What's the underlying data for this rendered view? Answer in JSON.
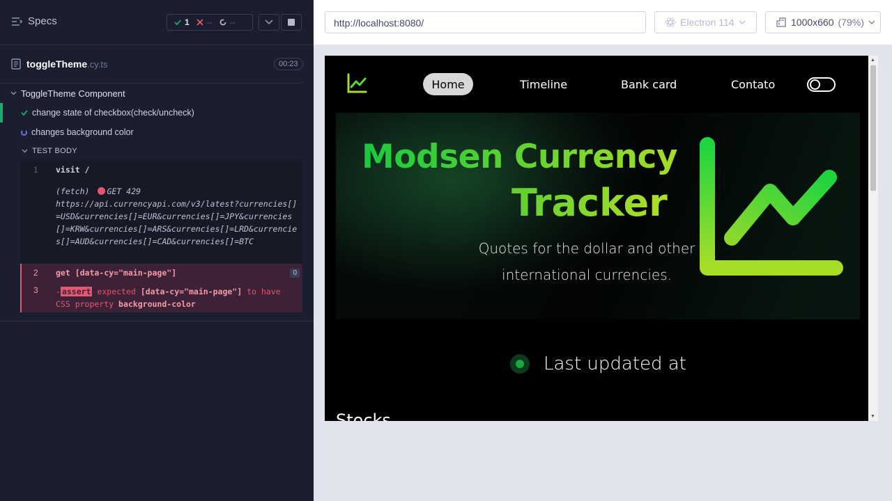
{
  "runner": {
    "specs_label": "Specs",
    "stats": {
      "passed": "1",
      "failed": "--",
      "pending": "--"
    },
    "spec_file": {
      "name": "toggleTheme",
      "ext": ".cy.ts",
      "duration": "00:23"
    },
    "suite": "ToggleTheme Component",
    "tests": [
      {
        "title": "change state of checkbox(check/uncheck)",
        "state": "passed"
      },
      {
        "title": "changes background color",
        "state": "running"
      }
    ],
    "test_body_label": "TEST BODY",
    "commands": [
      {
        "num": "1",
        "text": "visit  /",
        "fetch_label": "(fetch)",
        "fetch_status": "GET 429",
        "fetch_url": "https://api.currencyapi.com/v3/latest?currencies[]=USD&currencies[]=EUR&currencies[]=JPY&currencies[]=KRW&currencies[]=ARS&currencies[]=LRD&currencies[]=AUD&currencies[]=CAD&currencies[]=BTC"
      },
      {
        "num": "2",
        "text": "get  [data-cy=\"main-page\"]",
        "badge": "0"
      },
      {
        "num": "3",
        "dash": "-",
        "keyword": "assert",
        "part1": "expected",
        "selector": "[data-cy=\"main-page\"]",
        "part2": "to have CSS property",
        "prop": "background-color"
      }
    ]
  },
  "browser": {
    "url": "http://localhost:8080/",
    "browser_name": "Electron 114",
    "viewport": "1000x660",
    "zoom": "(79%)"
  },
  "app": {
    "nav": [
      "Home",
      "Timeline",
      "Bank card",
      "Contato"
    ],
    "hero_title_line1": "Modsen Currency",
    "hero_title_line2": "Tracker",
    "hero_subtitle": "Quotes for the dollar and other international currencies.",
    "last_updated": "Last updated at",
    "section_title": "Stocks"
  },
  "colors": {
    "runner_bg": "#1b1e2e",
    "pass": "#1fa971",
    "fail": "#e45770",
    "app_bg": "#000000",
    "accent_green": "#17c93f",
    "accent_lime": "#a6dd27"
  }
}
